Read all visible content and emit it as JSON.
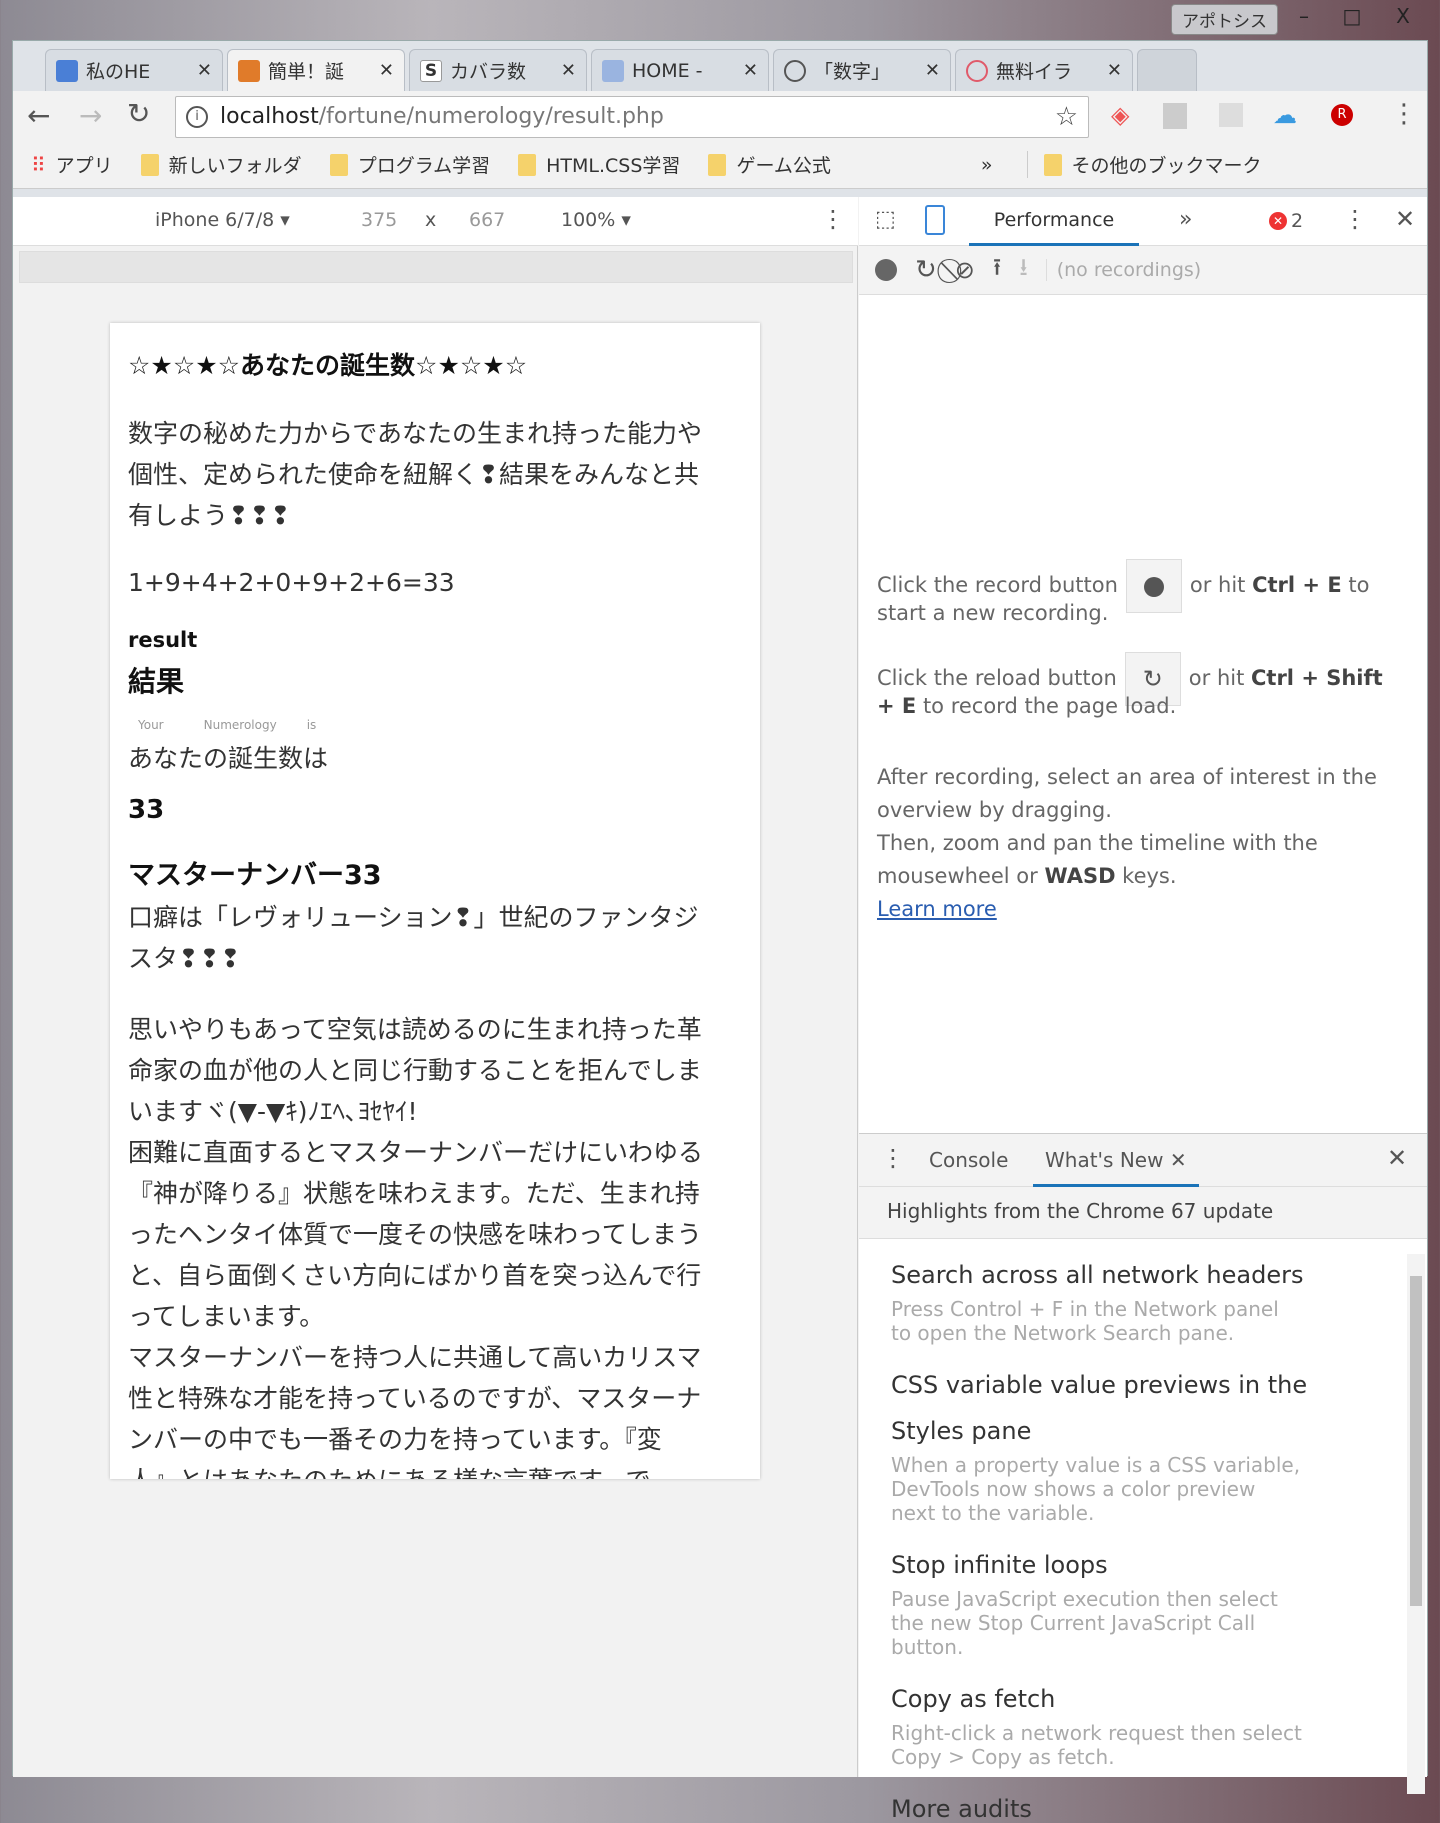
{
  "window": {
    "user_button": "アポトシス",
    "minimize": "–",
    "maximize": "□",
    "close": "X"
  },
  "tabs": [
    {
      "label": "私のHE",
      "color": "#4a7fd6"
    },
    {
      "label": "簡単！誕",
      "color": "#e07b2a"
    },
    {
      "label": "カバラ数",
      "color": "#555555"
    },
    {
      "label": "HOME -",
      "color": "#6a8cc8"
    },
    {
      "label": "「数字」",
      "color": "#555555"
    },
    {
      "label": "無料イラ",
      "color": "#e05a6a"
    }
  ],
  "address": {
    "host": "localhost",
    "path": "/fortune/numerology/result.php"
  },
  "bookmarks": {
    "apps": "アプリ",
    "items": [
      "新しいフォルダ",
      "プログラム学習",
      "HTML.CSS学習",
      "ゲーム公式"
    ],
    "more": "»",
    "other": "その他のブックマーク"
  },
  "device_toolbar": {
    "device": "iPhone 6/7/8",
    "width": "375",
    "times": "x",
    "height": "667",
    "zoom": "100%"
  },
  "page": {
    "heading": "☆★☆★☆あなたの誕生数☆★☆★☆",
    "intro": [
      "数字の秘めた力からであなたの生まれ持った能力や",
      "個性、定められた使命を紐解く❢結果をみんなと共",
      "有しよう❢❢❢"
    ],
    "formula": "1+9+4+2+0+9+2+6=33",
    "result_en": "result",
    "result_jp": "結果",
    "ruby": [
      "Your",
      "Numerology",
      "is"
    ],
    "your_number_label": "あなたの誕生数は",
    "number": "33",
    "master_title": "マスターナンバー33",
    "master_sub": [
      "口癖は「レヴォリューション❢」世紀のファンタジ",
      "スタ❢❢❢"
    ],
    "body": [
      "思いやりもあって空気は読めるのに生まれ持った革",
      "命家の血が他の人と同じ行動することを拒んでしま",
      "いますヾ(▼-▼ｷ)ﾉｴﾍ､ﾖｾﾔｲ!",
      "困難に直面するとマスターナンバーだけにいわゆる",
      "『神が降りる』状態を味わえます。ただ、生まれ持",
      "ったヘンタイ体質で一度その快感を味わってしまう",
      "と、自ら面倒くさい方向にばかり首を突っ込んで行",
      "ってしまいます。",
      "マスターナンバーを持つ人に共通して高いカリスマ",
      "性と特殊な才能を持っているのですが、マスターナ",
      "ンバーの中でも一番その力を持っています。『変",
      "人』とはあなたのためにある様な言葉です。で"
    ]
  },
  "devtools": {
    "panel_tab": "Performance",
    "more_tabs": "»",
    "error_count": "2",
    "no_recordings": "(no recordings)",
    "help": {
      "record_pre": "Click the record button",
      "record_post1": "or hit ",
      "record_keys": "Ctrl + E",
      "record_post2": " to",
      "record_line2": "start a new recording.",
      "reload_pre": "Click the reload button",
      "reload_post1": "or hit ",
      "reload_keys": "Ctrl + Shift",
      "reload_line2_keys": "+ E",
      "reload_line2": " to record the page load.",
      "after1": "After recording, select an area of interest in the",
      "after2": "overview by dragging.",
      "after3": "Then, zoom and pan the timeline with the",
      "after4_pre": "mousewheel or ",
      "after4_keys": "WASD",
      "after4_post": " keys.",
      "learn_more": "Learn more"
    },
    "drawer": {
      "tabs": [
        "Console",
        "What's New"
      ],
      "highlights": "Highlights from the Chrome 67 update",
      "items": [
        {
          "title": [
            "Search across all network headers"
          ],
          "desc": [
            "Press Control + F in the Network panel",
            "to open the Network Search pane."
          ]
        },
        {
          "title": [
            "CSS variable value previews in the",
            "Styles pane"
          ],
          "desc": [
            "When a property value is a CSS variable,",
            "DevTools now shows a color preview",
            "next to the variable."
          ]
        },
        {
          "title": [
            "Stop infinite loops"
          ],
          "desc": [
            "Pause JavaScript execution then select",
            "the new Stop Current JavaScript Call",
            "button."
          ]
        },
        {
          "title": [
            "Copy as fetch"
          ],
          "desc": [
            "Right-click a network request then select",
            "Copy > Copy as fetch."
          ]
        },
        {
          "title": [
            "More audits"
          ],
          "desc": []
        }
      ]
    }
  }
}
